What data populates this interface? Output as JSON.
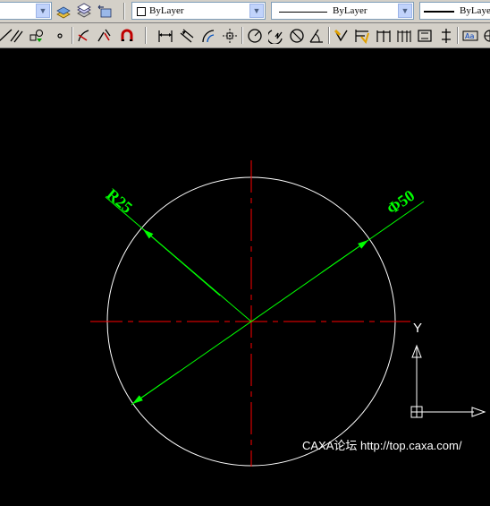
{
  "property_bar": {
    "color_value": "ByLayer",
    "linetype_value": "ByLayer",
    "lineweight_value": "ByLayer"
  },
  "toolbar_icons": [
    "layer-states-icon",
    "layer-icon",
    "layer-previous-icon",
    "line-icon",
    "parallel-line-icon",
    "chain-icon",
    "point-icon",
    "trim-icon",
    "break-icon",
    "magnet-icon",
    "linear-dimension-icon",
    "aligned-dimension-icon",
    "arc-length-dimension-icon",
    "ordinate-dimension-icon",
    "radius-dimension-icon",
    "jogged-dimension-icon",
    "diameter-dimension-icon",
    "angular-dimension-icon",
    "quick-dimension-icon",
    "baseline-dimension-icon",
    "continue-dimension-icon",
    "quick-leader-icon",
    "tolerance-icon",
    "center-mark-icon",
    "dimension-edit-icon",
    "dimension-text-edit-icon"
  ],
  "drawing": {
    "radius_label": "R25",
    "diameter_label": "Φ50",
    "ucs_y_label": "Y",
    "colors": {
      "background": "#000000",
      "circle": "#ffffff",
      "centerline": "#ff0000",
      "dimension": "#00ff00",
      "ucs": "#ffffff"
    }
  },
  "watermark": "CAXA论坛 http://top.caxa.com/"
}
